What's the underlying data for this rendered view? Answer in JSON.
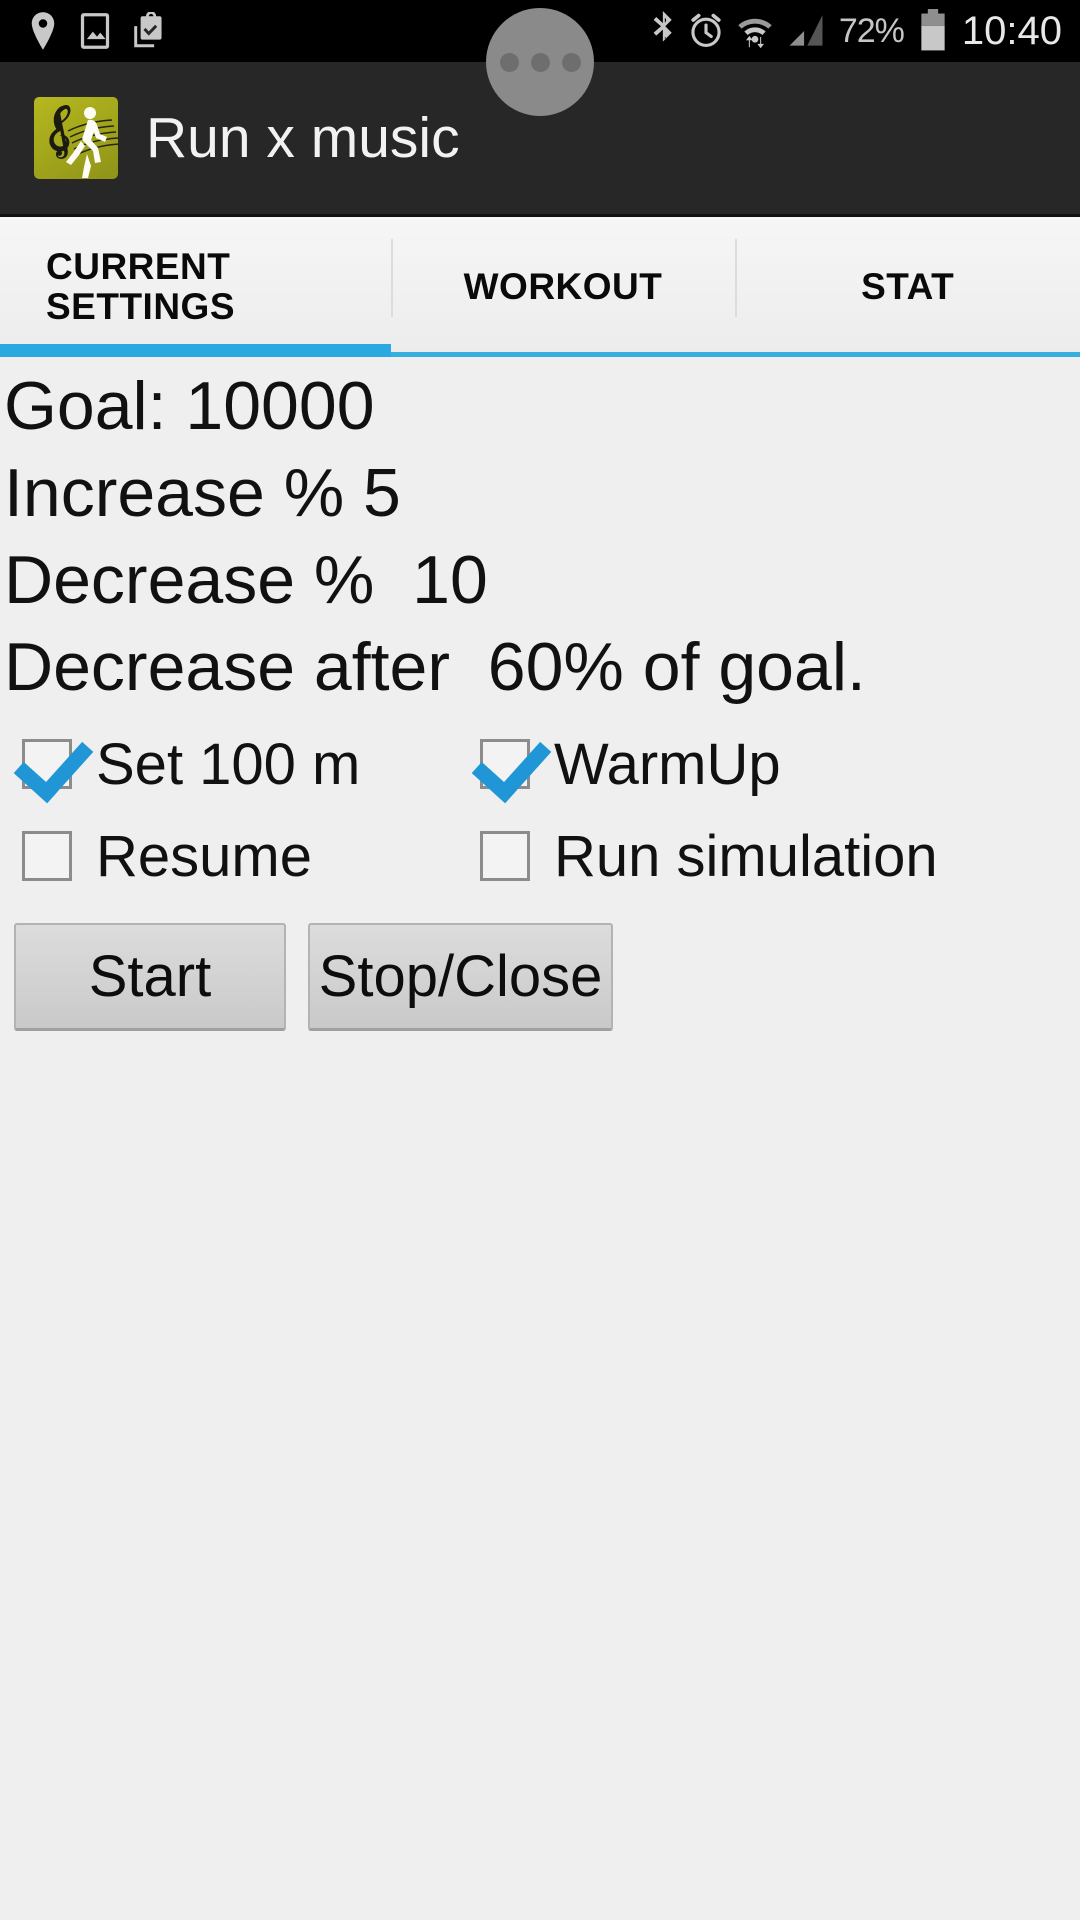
{
  "status_bar": {
    "icons_left": [
      "location-pin-icon",
      "screenshot-image-icon",
      "clipboard-check-icon"
    ],
    "icons_right": [
      "bluetooth-icon",
      "alarm-clock-icon",
      "wifi-transfer-icon",
      "cellular-signal-icon"
    ],
    "battery_percent": "72%",
    "battery_icon": "battery-icon",
    "time": "10:40"
  },
  "nav_overlay": {
    "name": "recent-apps-pill",
    "dots": 3
  },
  "app_bar": {
    "icon_name": "app-logo-run-x-music",
    "title": "Run x music"
  },
  "tabs": {
    "active_index": 0,
    "indicator_color": "#29a9df",
    "items": [
      {
        "label": "CURRENT\nSETTINGS",
        "name": "tab-current-settings",
        "line1": "CURRENT",
        "line2": "SETTINGS"
      },
      {
        "label": "WORKOUT",
        "name": "tab-workout"
      },
      {
        "label": "STAT",
        "name": "tab-stat"
      }
    ]
  },
  "settings": {
    "lines": [
      "Goal: 10000",
      "Increase % 5",
      "Decrease %  10",
      "Decrease after  60% of goal."
    ],
    "goal_label": "Goal:",
    "goal_value": "10000",
    "increase_label": "Increase %",
    "increase_value": "5",
    "decrease_label": "Decrease %",
    "decrease_value": "10",
    "decrease_after_label": "Decrease after",
    "decrease_after_value": "60% of goal."
  },
  "checkboxes": [
    {
      "label": "Set 100 m",
      "checked": true,
      "name": "checkbox-set-100-m"
    },
    {
      "label": "WarmUp",
      "checked": true,
      "name": "checkbox-warmup"
    },
    {
      "label": "Resume",
      "checked": false,
      "name": "checkbox-resume"
    },
    {
      "label": "Run simulation",
      "checked": false,
      "name": "checkbox-run-simulation"
    }
  ],
  "buttons": {
    "start": "Start",
    "stop": "Stop/Close"
  }
}
